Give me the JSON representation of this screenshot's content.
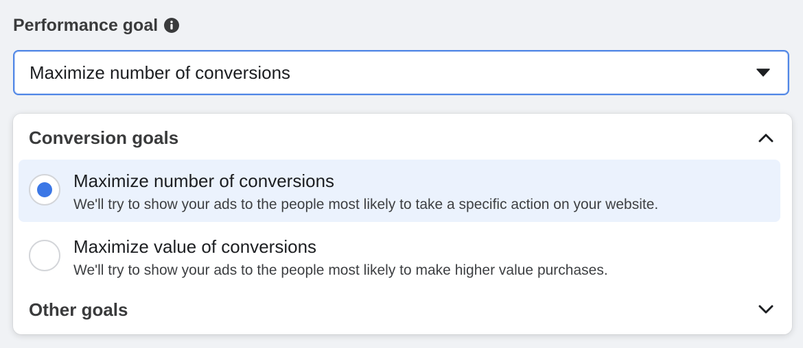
{
  "header": {
    "title": "Performance goal",
    "info_icon": "info-icon"
  },
  "select": {
    "value": "Maximize number of conversions",
    "icon": "caret-down-icon"
  },
  "menu": {
    "sections": [
      {
        "label": "Conversion goals",
        "expanded": true,
        "icon": "chevron-up-icon"
      },
      {
        "label": "Other goals",
        "expanded": false,
        "icon": "chevron-down-icon"
      }
    ],
    "options": [
      {
        "title": "Maximize number of conversions",
        "description": "We'll try to show your ads to the people most likely to take a specific action on your website.",
        "selected": true
      },
      {
        "title": "Maximize value of conversions",
        "description": "We'll try to show your ads to the people most likely to make higher value purchases.",
        "selected": false
      }
    ]
  },
  "colors": {
    "accent": "#3b77e6",
    "focus_border": "#4f86e6",
    "selected_bg": "#ebf2fd"
  }
}
